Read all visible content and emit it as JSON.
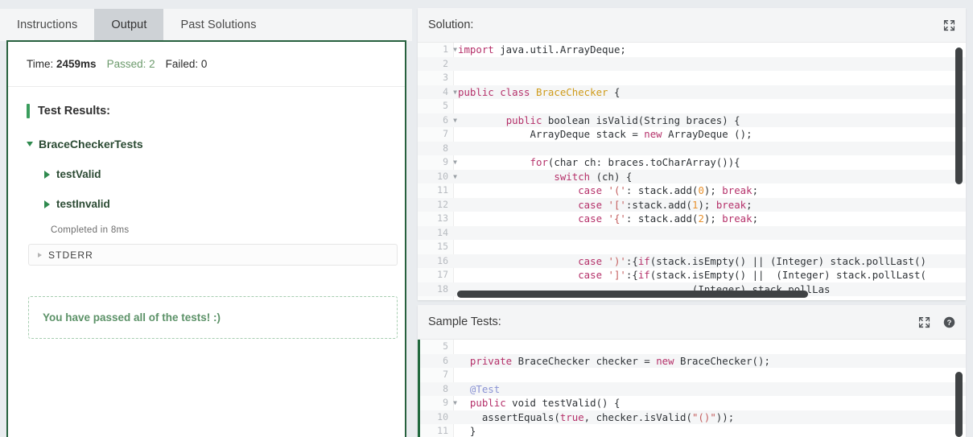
{
  "tabs": [
    {
      "label": "Instructions",
      "active": false
    },
    {
      "label": "Output",
      "active": true
    },
    {
      "label": "Past Solutions",
      "active": false
    }
  ],
  "output": {
    "summary": {
      "time_label": "Time:",
      "time_value": "2459ms",
      "passed_label": "Passed:",
      "passed_value": "2",
      "failed_label": "Failed:",
      "failed_value": "0"
    },
    "results_title": "Test Results:",
    "suite": {
      "name": "BraceCheckerTests",
      "tests": [
        {
          "name": "testValid"
        },
        {
          "name": "testInvalid"
        }
      ],
      "completed": "Completed in 8ms"
    },
    "stderr_label": "STDERR",
    "pass_message": "You have passed all of the tests! :)"
  },
  "solution": {
    "title": "Solution:",
    "expand_icon": "expand-icon",
    "code_lines": [
      {
        "n": "1",
        "fold": true,
        "tokens": [
          {
            "t": "import",
            "c": "kw"
          },
          {
            "t": " java.util.ArrayDeque;",
            "c": "pln"
          }
        ]
      },
      {
        "n": "2",
        "fold": false,
        "tokens": []
      },
      {
        "n": "3",
        "fold": false,
        "tokens": []
      },
      {
        "n": "4",
        "fold": true,
        "tokens": [
          {
            "t": "public class",
            "c": "kw"
          },
          {
            "t": " ",
            "c": "pln"
          },
          {
            "t": "BraceChecker",
            "c": "typ"
          },
          {
            "t": " {",
            "c": "pln"
          }
        ]
      },
      {
        "n": "5",
        "fold": false,
        "tokens": []
      },
      {
        "n": "6",
        "fold": true,
        "tokens": [
          {
            "t": "        ",
            "c": "pln"
          },
          {
            "t": "public",
            "c": "kw"
          },
          {
            "t": " boolean isValid(String braces) {",
            "c": "pln"
          }
        ]
      },
      {
        "n": "7",
        "fold": false,
        "tokens": [
          {
            "t": "            ArrayDeque stack = ",
            "c": "pln"
          },
          {
            "t": "new",
            "c": "kw"
          },
          {
            "t": " ArrayDeque ();",
            "c": "pln"
          }
        ]
      },
      {
        "n": "8",
        "fold": false,
        "tokens": []
      },
      {
        "n": "9",
        "fold": true,
        "tokens": [
          {
            "t": "            ",
            "c": "pln"
          },
          {
            "t": "for",
            "c": "kw"
          },
          {
            "t": "(char ch: braces.toCharArray()){",
            "c": "pln"
          }
        ]
      },
      {
        "n": "10",
        "fold": true,
        "tokens": [
          {
            "t": "                ",
            "c": "pln"
          },
          {
            "t": "switch",
            "c": "kw"
          },
          {
            "t": " (ch) {",
            "c": "pln"
          }
        ]
      },
      {
        "n": "11",
        "fold": false,
        "tokens": [
          {
            "t": "                    ",
            "c": "pln"
          },
          {
            "t": "case",
            "c": "kw"
          },
          {
            "t": " ",
            "c": "pln"
          },
          {
            "t": "'('",
            "c": "str"
          },
          {
            "t": ": stack.add(",
            "c": "pln"
          },
          {
            "t": "0",
            "c": "num"
          },
          {
            "t": "); ",
            "c": "pln"
          },
          {
            "t": "break",
            "c": "kw"
          },
          {
            "t": ";",
            "c": "pln"
          }
        ]
      },
      {
        "n": "12",
        "fold": false,
        "tokens": [
          {
            "t": "                    ",
            "c": "pln"
          },
          {
            "t": "case",
            "c": "kw"
          },
          {
            "t": " ",
            "c": "pln"
          },
          {
            "t": "'['",
            "c": "str"
          },
          {
            "t": ":stack.add(",
            "c": "pln"
          },
          {
            "t": "1",
            "c": "num"
          },
          {
            "t": "); ",
            "c": "pln"
          },
          {
            "t": "break",
            "c": "kw"
          },
          {
            "t": ";",
            "c": "pln"
          }
        ]
      },
      {
        "n": "13",
        "fold": false,
        "tokens": [
          {
            "t": "                    ",
            "c": "pln"
          },
          {
            "t": "case",
            "c": "kw"
          },
          {
            "t": " ",
            "c": "pln"
          },
          {
            "t": "'{'",
            "c": "str"
          },
          {
            "t": ": stack.add(",
            "c": "pln"
          },
          {
            "t": "2",
            "c": "num"
          },
          {
            "t": "); ",
            "c": "pln"
          },
          {
            "t": "break",
            "c": "kw"
          },
          {
            "t": ";",
            "c": "pln"
          }
        ]
      },
      {
        "n": "14",
        "fold": false,
        "tokens": []
      },
      {
        "n": "15",
        "fold": false,
        "tokens": []
      },
      {
        "n": "16",
        "fold": false,
        "tokens": [
          {
            "t": "                    ",
            "c": "pln"
          },
          {
            "t": "case",
            "c": "kw"
          },
          {
            "t": " ",
            "c": "pln"
          },
          {
            "t": "')'",
            "c": "str"
          },
          {
            "t": ":{",
            "c": "pln"
          },
          {
            "t": "if",
            "c": "kw"
          },
          {
            "t": "(stack.isEmpty() || (Integer) stack.pollLast()",
            "c": "pln"
          }
        ]
      },
      {
        "n": "17",
        "fold": false,
        "tokens": [
          {
            "t": "                    ",
            "c": "pln"
          },
          {
            "t": "case",
            "c": "kw"
          },
          {
            "t": " ",
            "c": "pln"
          },
          {
            "t": "']'",
            "c": "str"
          },
          {
            "t": ":{",
            "c": "pln"
          },
          {
            "t": "if",
            "c": "kw"
          },
          {
            "t": "(stack.isEmpty() ||  (Integer) stack.pollLast(",
            "c": "pln"
          }
        ]
      },
      {
        "n": "18",
        "fold": false,
        "tokens": [
          {
            "t": "                                       (Integer) stack.pollLas",
            "c": "pln"
          }
        ]
      }
    ]
  },
  "sample_tests": {
    "title": "Sample Tests:",
    "expand_icon": "expand-icon",
    "help_icon": "help-icon",
    "code_lines": [
      {
        "n": "5",
        "fold": false,
        "tokens": []
      },
      {
        "n": "6",
        "fold": false,
        "tokens": [
          {
            "t": "  ",
            "c": "pln"
          },
          {
            "t": "private",
            "c": "kw"
          },
          {
            "t": " BraceChecker checker = ",
            "c": "pln"
          },
          {
            "t": "new",
            "c": "kw"
          },
          {
            "t": " BraceChecker();",
            "c": "pln"
          }
        ]
      },
      {
        "n": "7",
        "fold": false,
        "tokens": []
      },
      {
        "n": "8",
        "fold": false,
        "tokens": [
          {
            "t": "  ",
            "c": "pln"
          },
          {
            "t": "@Test",
            "c": "ann"
          }
        ]
      },
      {
        "n": "9",
        "fold": true,
        "tokens": [
          {
            "t": "  ",
            "c": "pln"
          },
          {
            "t": "public",
            "c": "kw"
          },
          {
            "t": " void testValid() {",
            "c": "pln"
          }
        ]
      },
      {
        "n": "10",
        "fold": false,
        "tokens": [
          {
            "t": "    assertEquals(",
            "c": "pln"
          },
          {
            "t": "true",
            "c": "kw"
          },
          {
            "t": ", checker.isValid(",
            "c": "pln"
          },
          {
            "t": "\"()\"",
            "c": "str"
          },
          {
            "t": "));",
            "c": "pln"
          }
        ]
      },
      {
        "n": "11",
        "fold": false,
        "tokens": [
          {
            "t": "  }",
            "c": "pln"
          }
        ]
      }
    ]
  },
  "colors": {
    "accent_green": "#27613e",
    "pass_green": "#5c9268",
    "tab_active_bg": "#ced2d6",
    "panel_bg": "#e9ecef",
    "scrollbar": "#3f4244"
  }
}
